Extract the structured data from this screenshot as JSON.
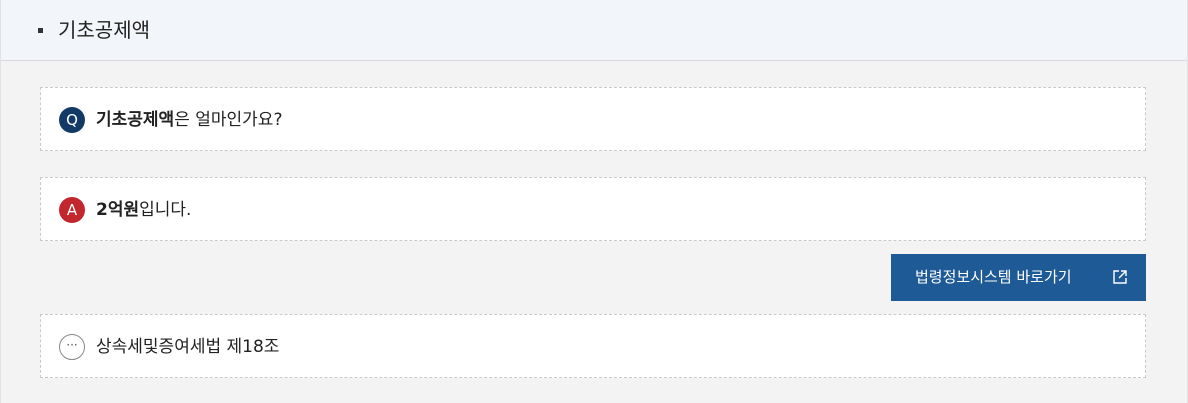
{
  "header": {
    "title": "기초공제액"
  },
  "question": {
    "badge": "Q",
    "bold": "기초공제액",
    "rest": "은 얼마인가요?"
  },
  "answer": {
    "badge": "A",
    "bold": "2억원",
    "rest": "입니다."
  },
  "link_button": {
    "label": "법령정보시스템 바로가기",
    "icon": "external-link-icon"
  },
  "law": {
    "badge": "···",
    "text": "상속세및증여세법 제18조"
  },
  "colors": {
    "question_badge": "#133a66",
    "answer_badge": "#c2272d",
    "button": "#1e5b96",
    "header_bg": "#f2f5fa",
    "panel_bg": "#f3f3f3"
  }
}
